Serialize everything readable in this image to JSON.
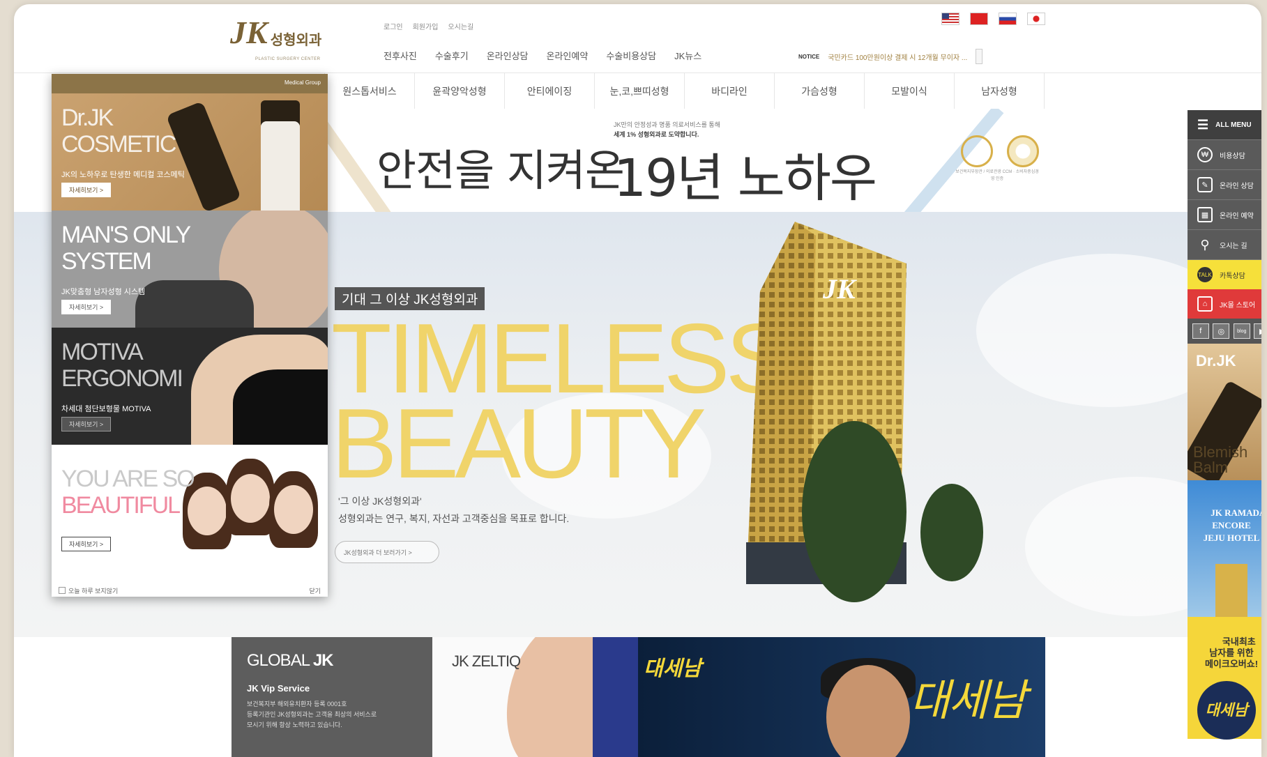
{
  "header": {
    "logo": {
      "mark": "JK",
      "text": "성형외과",
      "sub": "PLASTIC SURGERY CENTER"
    },
    "util_links": [
      "로그인",
      "회원가입",
      "오시는길"
    ],
    "gnb": [
      "전후사진",
      "수술후기",
      "온라인상담",
      "온라인예약",
      "수술비용상담",
      "JK뉴스"
    ],
    "flags": [
      "us-flag-icon",
      "cn-flag-icon",
      "ru-flag-icon",
      "jp-flag-icon"
    ],
    "notice": {
      "label": "NOTICE",
      "text": "국민카드 100만원이상 결제 시 12개월 무이자 ..."
    }
  },
  "subnav": [
    "원스톱서비스",
    "윤곽양악성형",
    "안티에이징",
    "눈,코,쁘띠성형",
    "바디라인",
    "가슴성형",
    "모발이식",
    "남자성형"
  ],
  "banner": {
    "main": "안전을 지켜온",
    "big": "19년 노하우",
    "small1": "JK만의 안정성과 명품 의료서비스를 통해",
    "small2": "세계 1% 성형외과로 도약합니다.",
    "award_text": "보건복지부장관 / 의료관광 CCM · 소비자중심경영 인증"
  },
  "hero": {
    "tag": "기대 그 이상 JK성형외과",
    "title": "TIMELESS\nBEAUTY",
    "sub1": "'그 이상 JK성형외과'",
    "sub2": "성형외과는 연구, 복지, 자선과 고객중심을 목표로 합니다.",
    "button": "JK성형외과 더 보러가기  >"
  },
  "popup": {
    "header": "Medical Group",
    "slots": [
      {
        "title": "Dr.JK\nCOSMETIC",
        "desc": "JK의 노하우로 탄생한 메디컬 코스메틱",
        "more": "자세히보기 >"
      },
      {
        "title": "MAN'S ONLY\nSYSTEM",
        "desc": "JK맞춤형 남자성형 시스템",
        "more": "자세히보기 >"
      },
      {
        "title": "MOTIVA\nERGONOMI",
        "desc": "차세대 첨단보형물 MOTIVA",
        "more": "자세히보기 >"
      },
      {
        "title_a": "YOU ARE SO",
        "title_b": "BEAUTIFUL",
        "more": "자세히보기 >"
      }
    ],
    "footer_check": "오늘 하루 보지않기",
    "footer_close": "닫기"
  },
  "quick_menu": {
    "all": "ALL MENU",
    "items": [
      {
        "label": "비용상담",
        "icon": "won-icon"
      },
      {
        "label": "온라인 상담",
        "icon": "chat-icon"
      },
      {
        "label": "온라인 예약",
        "icon": "calendar-icon"
      },
      {
        "label": "오시는 길",
        "icon": "location-icon"
      },
      {
        "label": "카톡상담",
        "icon": "talk-icon"
      },
      {
        "label": "JK몰 스토어",
        "icon": "store-icon"
      }
    ],
    "sns": [
      "facebook-icon",
      "instagram-icon",
      "blog-icon",
      "youtube-icon"
    ],
    "ad1": {
      "title": "Dr.JK",
      "text": "Blemish\nBalm"
    },
    "ad2": {
      "text": "JK RAMADA\nENCORE\nJEJU HOTEL"
    },
    "ad3": {
      "text": "국내최초\n남자를 위한\n메이크오버쇼!",
      "logo": "대세남"
    }
  },
  "bottom": {
    "global": {
      "title_a": "GLOBAL ",
      "title_b": "JK",
      "sub": "JK Vip Service",
      "desc": "보건복지부 해외유치환자 등록 0001호\n등록기관인 JK성형외과는 고객을 최상의 서비스로\n모시기 위해 항상 노력하고 있습니다."
    },
    "zeltiq": {
      "title": "JK ZELTIQ"
    },
    "show": {
      "logo": "대세남",
      "logo_big": "대세남"
    }
  },
  "colors": {
    "gold": "#f0d46a",
    "brand": "#7a6236",
    "kakao": "#f6e03a",
    "store": "#e03a3a"
  }
}
